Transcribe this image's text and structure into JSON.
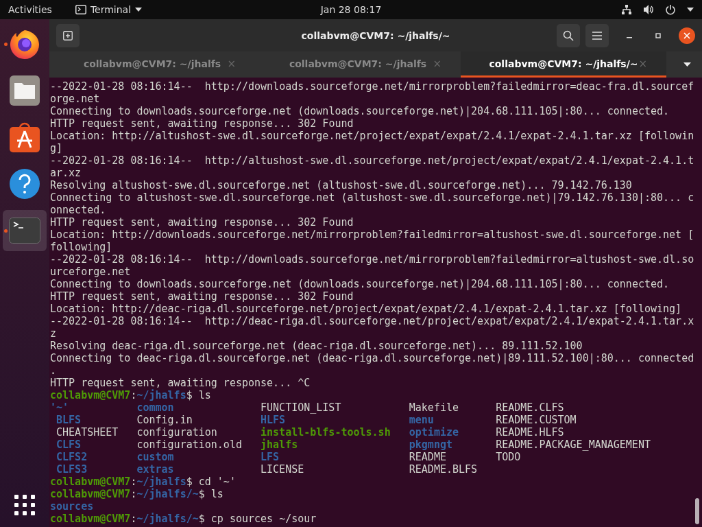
{
  "top_bar": {
    "activities": "Activities",
    "app_menu": "Terminal",
    "clock": "Jan 28  08:17"
  },
  "dock": {
    "items": [
      {
        "kind": "firefox",
        "running": true,
        "selected": false
      },
      {
        "kind": "files",
        "running": false,
        "selected": false
      },
      {
        "kind": "software",
        "running": false,
        "selected": false
      },
      {
        "kind": "help",
        "running": false,
        "selected": false
      },
      {
        "kind": "terminal",
        "running": true,
        "selected": true
      }
    ]
  },
  "window": {
    "title": "collabvm@CVM7: ~/jhalfs/~"
  },
  "tabs": [
    {
      "label": "collabvm@CVM7: ~/jhalfs",
      "close": "×",
      "selected": false
    },
    {
      "label": "collabvm@CVM7: ~/jhalfs",
      "close": "×",
      "selected": false
    },
    {
      "label": "collabvm@CVM7: ~/jhalfs/~",
      "close": "×",
      "selected": true
    }
  ],
  "terminal": {
    "lines": [
      {
        "kind": "text",
        "text": "--2022-01-28 08:16:14--  http://downloads.sourceforge.net/mirrorproblem?failedmirror=deac-fra.dl.sourceforge.net"
      },
      {
        "kind": "text",
        "text": "Connecting to downloads.sourceforge.net (downloads.sourceforge.net)|204.68.111.105|:80... connected."
      },
      {
        "kind": "text",
        "text": "HTTP request sent, awaiting response... 302 Found"
      },
      {
        "kind": "text",
        "text": "Location: http://altushost-swe.dl.sourceforge.net/project/expat/expat/2.4.1/expat-2.4.1.tar.xz [following]"
      },
      {
        "kind": "text",
        "text": "--2022-01-28 08:16:14--  http://altushost-swe.dl.sourceforge.net/project/expat/expat/2.4.1/expat-2.4.1.tar.xz"
      },
      {
        "kind": "text",
        "text": "Resolving altushost-swe.dl.sourceforge.net (altushost-swe.dl.sourceforge.net)... 79.142.76.130"
      },
      {
        "kind": "text",
        "text": "Connecting to altushost-swe.dl.sourceforge.net (altushost-swe.dl.sourceforge.net)|79.142.76.130|:80... connected."
      },
      {
        "kind": "text",
        "text": "HTTP request sent, awaiting response... 302 Found"
      },
      {
        "kind": "text",
        "text": "Location: http://downloads.sourceforge.net/mirrorproblem?failedmirror=altushost-swe.dl.sourceforge.net [following]"
      },
      {
        "kind": "text",
        "text": "--2022-01-28 08:16:14--  http://downloads.sourceforge.net/mirrorproblem?failedmirror=altushost-swe.dl.sourceforge.net"
      },
      {
        "kind": "text",
        "text": "Connecting to downloads.sourceforge.net (downloads.sourceforge.net)|204.68.111.105|:80... connected."
      },
      {
        "kind": "text",
        "text": "HTTP request sent, awaiting response... 302 Found"
      },
      {
        "kind": "text",
        "text": "Location: http://deac-riga.dl.sourceforge.net/project/expat/expat/2.4.1/expat-2.4.1.tar.xz [following]"
      },
      {
        "kind": "text",
        "text": "--2022-01-28 08:16:14--  http://deac-riga.dl.sourceforge.net/project/expat/expat/2.4.1/expat-2.4.1.tar.xz"
      },
      {
        "kind": "text",
        "text": "Resolving deac-riga.dl.sourceforge.net (deac-riga.dl.sourceforge.net)... 89.111.52.100"
      },
      {
        "kind": "text",
        "text": "Connecting to deac-riga.dl.sourceforge.net (deac-riga.dl.sourceforge.net)|89.111.52.100|:80... connected."
      },
      {
        "kind": "text",
        "text": "HTTP request sent, awaiting response... ^C"
      },
      {
        "kind": "prompt",
        "user": "collabvm@CVM7",
        "separator": ":",
        "path": "~/jhalfs",
        "input": "$ ls"
      },
      {
        "kind": "listing",
        "rows": [
          [
            {
              "name": "'~'",
              "kind": "dir"
            },
            {
              "name": "common",
              "kind": "dir"
            },
            {
              "name": "FUNCTION_LIST",
              "kind": "file"
            },
            {
              "name": "Makefile",
              "kind": "file"
            },
            {
              "name": "README.CLFS",
              "kind": "file"
            }
          ],
          [
            {
              "name": " BLFS",
              "kind": "dir"
            },
            {
              "name": "Config.in",
              "kind": "file"
            },
            {
              "name": "HLFS",
              "kind": "dir"
            },
            {
              "name": "menu",
              "kind": "dir"
            },
            {
              "name": "README.CUSTOM",
              "kind": "file"
            }
          ],
          [
            {
              "name": " CHEATSHEET",
              "kind": "file"
            },
            {
              "name": "configuration",
              "kind": "file"
            },
            {
              "name": "install-blfs-tools.sh",
              "kind": "exec"
            },
            {
              "name": "optimize",
              "kind": "dir"
            },
            {
              "name": "README.HLFS",
              "kind": "file"
            }
          ],
          [
            {
              "name": " CLFS",
              "kind": "dir"
            },
            {
              "name": "configuration.old",
              "kind": "file"
            },
            {
              "name": "jhalfs",
              "kind": "exec"
            },
            {
              "name": "pkgmngt",
              "kind": "dir"
            },
            {
              "name": "README.PACKAGE_MANAGEMENT",
              "kind": "file"
            }
          ],
          [
            {
              "name": " CLFS2",
              "kind": "dir"
            },
            {
              "name": "custom",
              "kind": "dir"
            },
            {
              "name": "LFS",
              "kind": "dir"
            },
            {
              "name": "README",
              "kind": "file"
            },
            {
              "name": "TODO",
              "kind": "file"
            }
          ],
          [
            {
              "name": " CLFS3",
              "kind": "dir"
            },
            {
              "name": "extras",
              "kind": "dir"
            },
            {
              "name": "LICENSE",
              "kind": "file"
            },
            {
              "name": "README.BLFS",
              "kind": "file"
            }
          ]
        ]
      },
      {
        "kind": "prompt",
        "user": "collabvm@CVM7",
        "separator": ":",
        "path": "~/jhalfs",
        "input": "$ cd '~'"
      },
      {
        "kind": "prompt",
        "user": "collabvm@CVM7",
        "separator": ":",
        "path": "~/jhalfs/~",
        "input": "$ ls"
      },
      {
        "kind": "listing",
        "rows": [
          [
            {
              "name": "sources",
              "kind": "dir"
            }
          ]
        ]
      },
      {
        "kind": "prompt",
        "user": "collabvm@CVM7",
        "separator": ":",
        "path": "~/jhalfs/~",
        "input": "$ cp sources ~/sour"
      }
    ]
  }
}
